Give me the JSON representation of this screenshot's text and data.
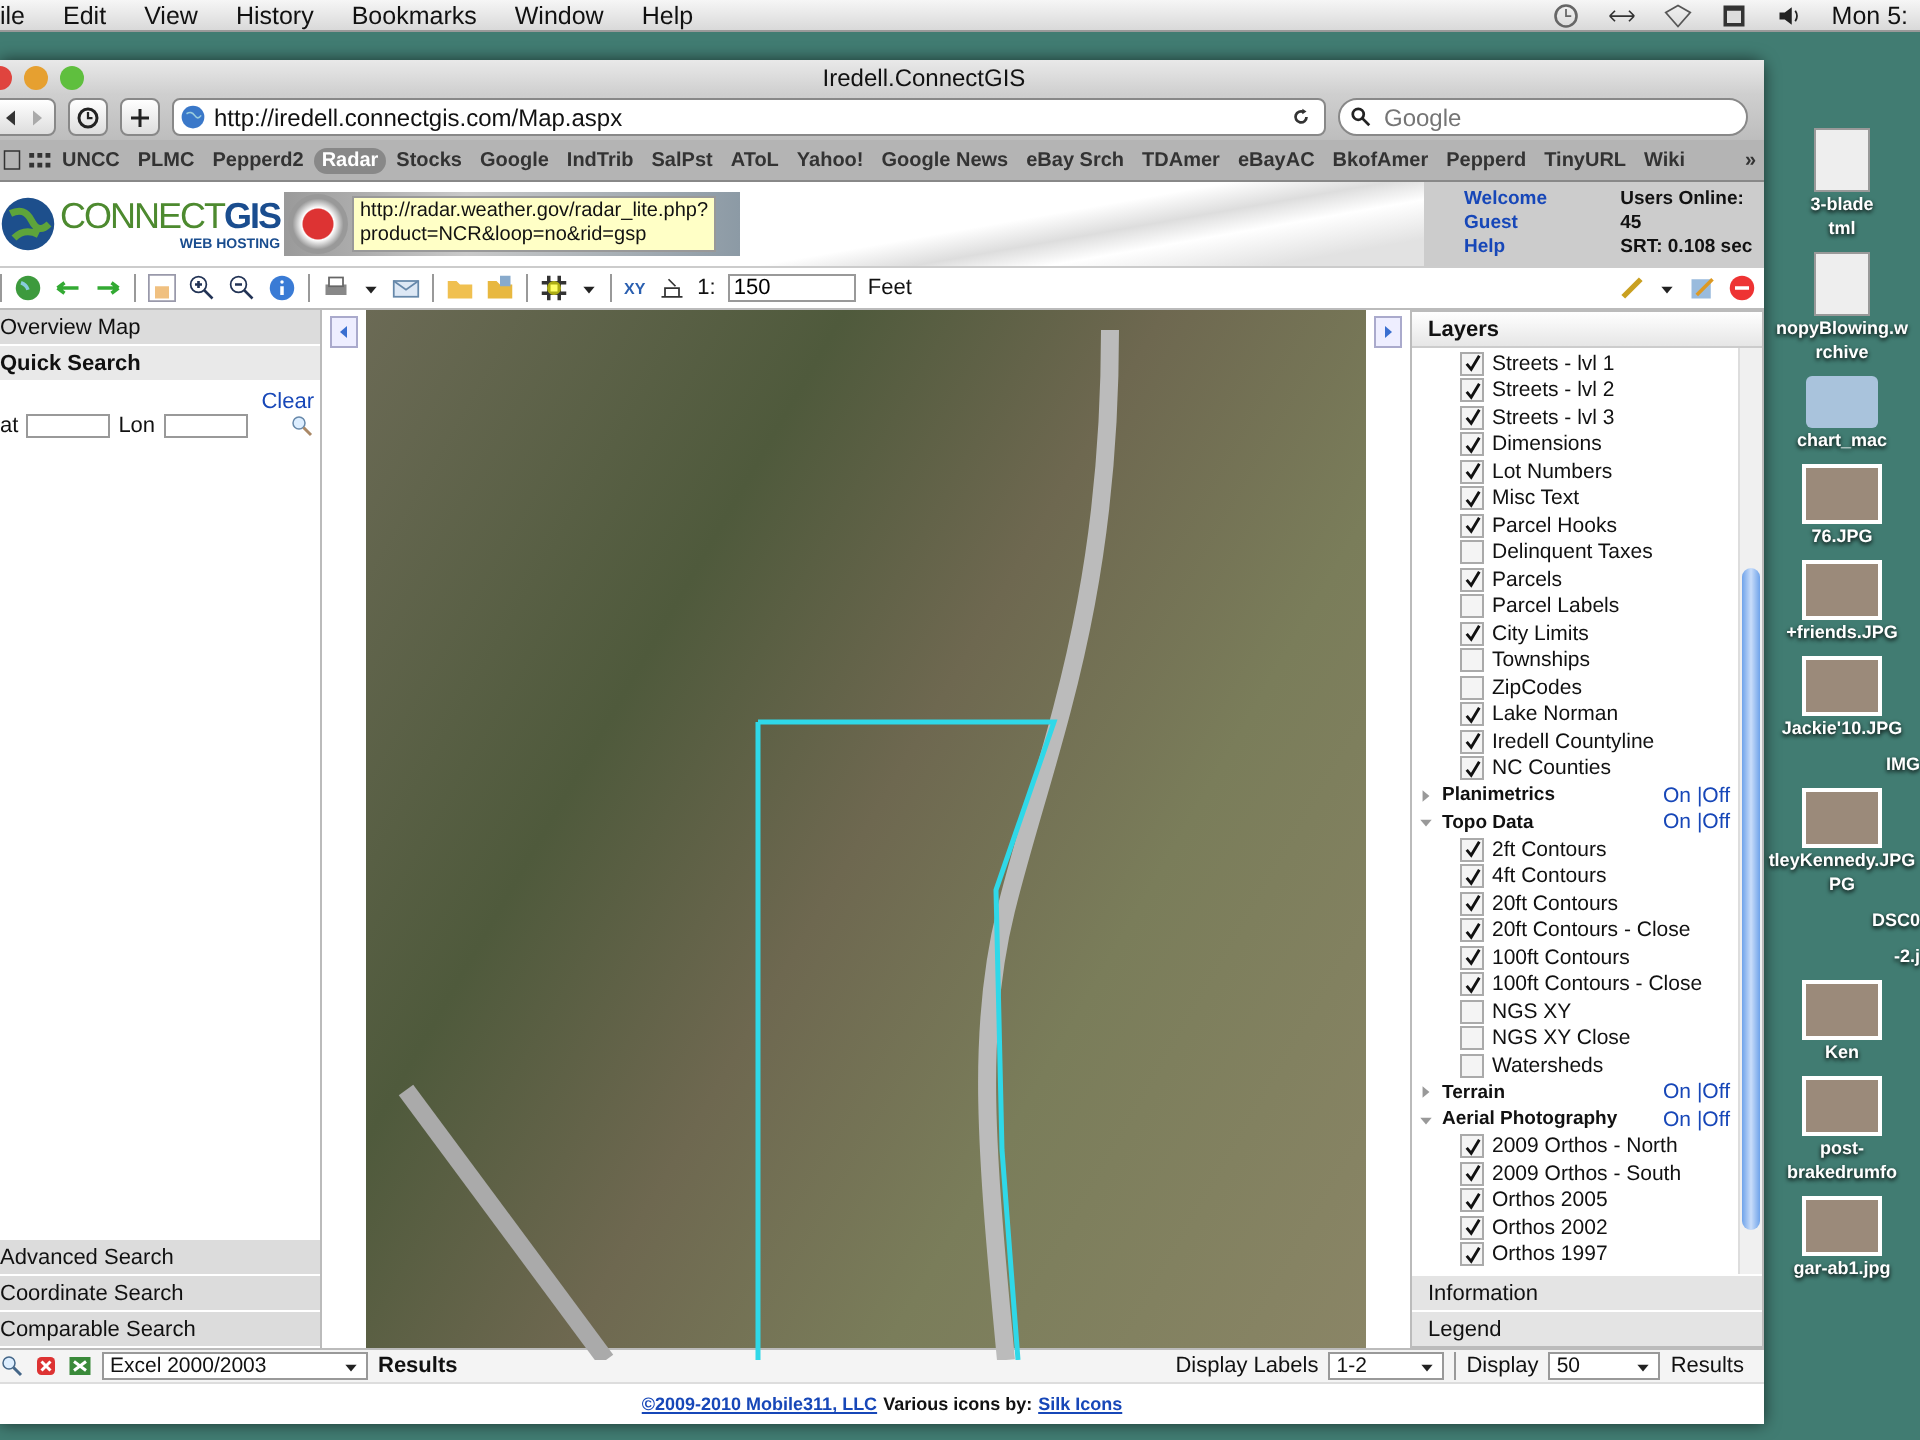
{
  "menubar": {
    "menus": [
      "ile",
      "Edit",
      "View",
      "History",
      "Bookmarks",
      "Window",
      "Help"
    ],
    "clock": "Mon 5:"
  },
  "browser": {
    "title": "Iredell.ConnectGIS",
    "url": "http://iredell.connectgis.com/Map.aspx",
    "search_placeholder": "Google",
    "overflow": "»",
    "bookmarks": [
      {
        "label": "UNCC",
        "selected": false
      },
      {
        "label": "PLMC",
        "selected": false
      },
      {
        "label": "Pepperd2",
        "selected": false
      },
      {
        "label": "Radar",
        "selected": true
      },
      {
        "label": "Stocks",
        "selected": false
      },
      {
        "label": "Google",
        "selected": false
      },
      {
        "label": "IndTrib",
        "selected": false
      },
      {
        "label": "SalPst",
        "selected": false
      },
      {
        "label": "AToL",
        "selected": false
      },
      {
        "label": "Yahoo!",
        "selected": false
      },
      {
        "label": "Google News",
        "selected": false
      },
      {
        "label": "eBay Srch",
        "selected": false
      },
      {
        "label": "TDAmer",
        "selected": false
      },
      {
        "label": "eBayAC",
        "selected": false
      },
      {
        "label": "BkofAmer",
        "selected": false
      },
      {
        "label": "Pepperd",
        "selected": false
      },
      {
        "label": "TinyURL",
        "selected": false
      },
      {
        "label": "Wiki",
        "selected": false
      }
    ]
  },
  "header": {
    "logo": "CONNECT**GIS**",
    "logo_subtitle": "WEB HOSTING",
    "tooltip_lines": [
      "http://radar.weather.gov/radar_lite.php?",
      "product=NCR&loop=no&rid=gsp"
    ],
    "welcome": "Welcome Guest",
    "help": "Help",
    "users_online": "Users Online: 45",
    "srt": "SRT: 0.108 sec"
  },
  "toolbar": {
    "xy": "XY",
    "scale_prefix": "1:",
    "scale": "150",
    "units": "Feet"
  },
  "left_panel": {
    "sections_top": [
      "Overview Map",
      "Quick Search"
    ],
    "clear": "Clear",
    "lat_label": "at",
    "lon_label": "Lon",
    "sections_bottom": [
      "Advanced Search",
      "Coordinate Search",
      "Comparable Search"
    ]
  },
  "layers": {
    "title": "Layers",
    "items": [
      {
        "kind": "layer",
        "label": "Streets - lvl 1",
        "checked": true
      },
      {
        "kind": "layer",
        "label": "Streets - lvl 2",
        "checked": true
      },
      {
        "kind": "layer",
        "label": "Streets - lvl 3",
        "checked": true
      },
      {
        "kind": "layer",
        "label": "Dimensions",
        "checked": true
      },
      {
        "kind": "layer",
        "label": "Lot Numbers",
        "checked": true
      },
      {
        "kind": "layer",
        "label": "Misc Text",
        "checked": true
      },
      {
        "kind": "layer",
        "label": "Parcel Hooks",
        "checked": true
      },
      {
        "kind": "layer",
        "label": "Delinquent Taxes",
        "checked": false
      },
      {
        "kind": "layer",
        "label": "Parcels",
        "checked": true
      },
      {
        "kind": "layer",
        "label": "Parcel Labels",
        "checked": false
      },
      {
        "kind": "layer",
        "label": "City Limits",
        "checked": true
      },
      {
        "kind": "layer",
        "label": "Townships",
        "checked": false
      },
      {
        "kind": "layer",
        "label": "ZipCodes",
        "checked": false
      },
      {
        "kind": "layer",
        "label": "Lake Norman",
        "checked": true
      },
      {
        "kind": "layer",
        "label": "Iredell Countyline",
        "checked": true
      },
      {
        "kind": "layer",
        "label": "NC Counties",
        "checked": true
      },
      {
        "kind": "group",
        "label": "Planimetrics",
        "expanded": false,
        "on_label": "On",
        "off_label": "|Off"
      },
      {
        "kind": "group",
        "label": "Topo Data",
        "expanded": true,
        "on_label": "On",
        "off_label": "|Off",
        "children": [
          {
            "kind": "layer",
            "label": "2ft Contours",
            "checked": true
          },
          {
            "kind": "layer",
            "label": "4ft Contours",
            "checked": true
          },
          {
            "kind": "layer",
            "label": "20ft Contours",
            "checked": true
          },
          {
            "kind": "layer",
            "label": "20ft Contours - Close",
            "checked": true
          },
          {
            "kind": "layer",
            "label": "100ft Contours",
            "checked": true
          },
          {
            "kind": "layer",
            "label": "100ft Contours - Close",
            "checked": true
          },
          {
            "kind": "layer",
            "label": "NGS XY",
            "checked": false
          },
          {
            "kind": "layer",
            "label": "NGS XY Close",
            "checked": false
          },
          {
            "kind": "layer",
            "label": "Watersheds",
            "checked": false
          }
        ]
      },
      {
        "kind": "group",
        "label": "Terrain",
        "expanded": false,
        "on_label": "On",
        "off_label": "|Off"
      },
      {
        "kind": "group",
        "label": "Aerial Photography",
        "expanded": true,
        "on_label": "On",
        "off_label": "|Off",
        "children": [
          {
            "kind": "layer",
            "label": "2009 Orthos - North",
            "checked": true
          },
          {
            "kind": "layer",
            "label": "2009 Orthos - South",
            "checked": true
          },
          {
            "kind": "layer",
            "label": "Orthos 2005",
            "checked": true
          },
          {
            "kind": "layer",
            "label": "Orthos 2002",
            "checked": true
          },
          {
            "kind": "layer",
            "label": "Orthos 1997",
            "checked": true
          }
        ]
      }
    ]
  },
  "right_sections": [
    "Information",
    "Legend"
  ],
  "results_bar": {
    "export_format": "Excel 2000/2003",
    "results": "Results",
    "display_labels": "Display Labels",
    "labels_value": "1-2",
    "display": "Display",
    "display_value": "50",
    "results_right": "Results"
  },
  "footer": {
    "copyright": "©2009-2010 Mobile311, LLC",
    "credit": "Various icons by:",
    "icons_link": "Silk Icons"
  },
  "desktop_icons": [
    {
      "kind": "document",
      "lines": [
        "3-blade",
        "tml"
      ]
    },
    {
      "kind": "document",
      "lines": [
        "nopyBlowing.w",
        "rchive"
      ]
    },
    {
      "kind": "folder",
      "lines": [
        "chart_mac"
      ]
    },
    {
      "kind": "photo",
      "lines": [
        "76.JPG"
      ]
    },
    {
      "kind": "photo",
      "lines": [
        "+friends.JPG"
      ]
    },
    {
      "kind": "photo",
      "lines": [
        "Jackie'10.JPG"
      ]
    },
    {
      "kind": "label",
      "lines": [
        "IMG"
      ]
    },
    {
      "kind": "photo",
      "lines": [
        "tleyKennedy.JPG",
        "PG"
      ]
    },
    {
      "kind": "label",
      "lines": [
        "DSC0"
      ]
    },
    {
      "kind": "label",
      "lines": [
        "-2.j"
      ]
    },
    {
      "kind": "photo",
      "lines": [
        "Ken"
      ]
    },
    {
      "kind": "photo",
      "lines": [
        "post-",
        "brakedrumfo"
      ]
    },
    {
      "kind": "photo",
      "lines": [
        "gar-ab1.jpg"
      ]
    }
  ]
}
